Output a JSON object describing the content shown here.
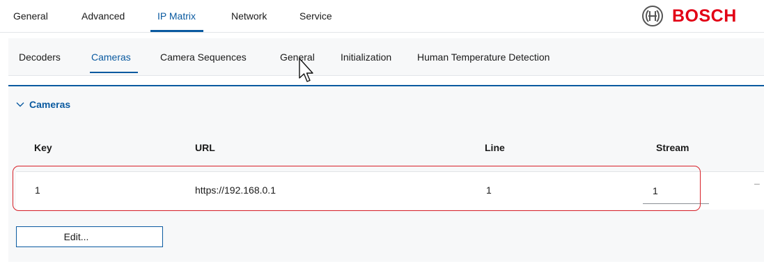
{
  "top_nav": {
    "tabs": [
      "General",
      "Advanced",
      "IP Matrix",
      "Network",
      "Service"
    ],
    "active": "IP Matrix"
  },
  "brand": {
    "name": "BOSCH",
    "logo_icon": "bosch-armature-icon",
    "color": "#e20015"
  },
  "sub_nav": {
    "tabs": [
      "Decoders",
      "Cameras",
      "Camera Sequences",
      "General",
      "Initialization",
      "Human Temperature Detection"
    ],
    "active": "Cameras"
  },
  "section": {
    "title": "Cameras",
    "expanded": true,
    "icon": "chevron-down-icon"
  },
  "table": {
    "headers": [
      "Key",
      "URL",
      "Line",
      "Stream"
    ],
    "rows": [
      {
        "key": "1",
        "url": "https://192.168.0.1",
        "line": "1",
        "stream": "1",
        "trailing": "–"
      }
    ]
  },
  "buttons": {
    "edit": "Edit..."
  },
  "colors": {
    "accent": "#0a5aa0",
    "highlight": "#d82028"
  }
}
